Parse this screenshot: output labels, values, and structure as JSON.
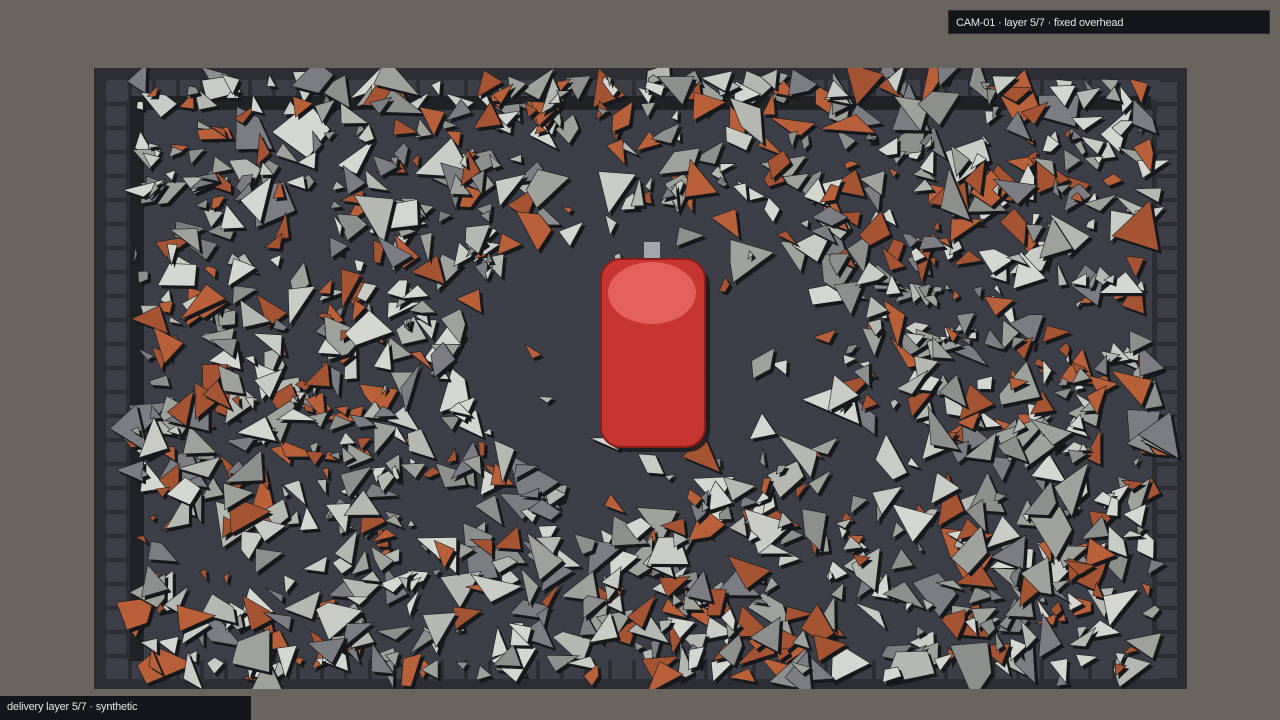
{
  "camera": {
    "label": "CAM-01 · layer 5/7 · fixed overhead"
  },
  "footer": {
    "label": "delivery layer 5/7 · synthetic"
  },
  "scene": {
    "background": "#69655e",
    "arena_rim": "#2c2e34",
    "floor_color": "#3c3f47",
    "wall_color": "#202226",
    "object": {
      "name": "red-canister",
      "body_color": "#c63530",
      "highlight_color": "#e2615a",
      "cap_color": "#a2a5ab"
    },
    "debris_palette": [
      "#9ea29a",
      "#b5b8b0",
      "#c9ccc4",
      "#8d8f8c",
      "#a45433",
      "#b8603a",
      "#7b7d82",
      "#d4d6d0"
    ]
  }
}
